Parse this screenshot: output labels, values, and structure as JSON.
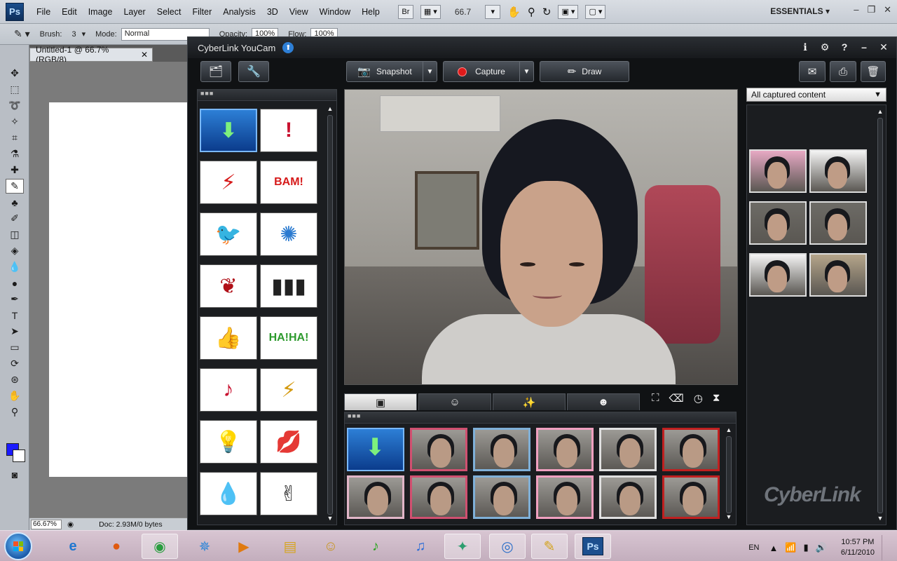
{
  "photoshop": {
    "logo": "Ps",
    "menu": [
      "File",
      "Edit",
      "Image",
      "Layer",
      "Select",
      "Filter",
      "Analysis",
      "3D",
      "View",
      "Window",
      "Help"
    ],
    "bridge_label": "Br",
    "zoom": "66.7",
    "workspace": "ESSENTIALS",
    "options": {
      "brush_label": "Brush:",
      "brush_size": "3",
      "mode_label": "Mode:",
      "mode_value": "Normal",
      "opacity_label": "Opacity:",
      "opacity_value": "100%",
      "flow_label": "Flow:",
      "flow_value": "100%"
    },
    "document_tab": "Untitled-1 @ 66.7% (RGB/8)",
    "status": {
      "zoom": "66.67%",
      "doc_info": "Doc: 2.93M/0 bytes"
    },
    "foreground_color": "#1a1aff",
    "background_color": "#ffffff"
  },
  "youcam": {
    "title": "CyberLink YouCam",
    "buttons": {
      "snapshot": "Snapshot",
      "capture": "Capture",
      "draw": "Draw"
    },
    "effects": [
      {
        "name": "download-effect",
        "text": "⬇",
        "selected": true
      },
      {
        "name": "exclaim-effect",
        "text": "!"
      },
      {
        "name": "zigzag-effect",
        "text": "⚡"
      },
      {
        "name": "bam-effect",
        "text": "BAM!"
      },
      {
        "name": "bird-effect",
        "text": "🐦"
      },
      {
        "name": "confetti-effect",
        "text": "✺"
      },
      {
        "name": "lips-confetti-effect",
        "text": "❦"
      },
      {
        "name": "fringe-effect",
        "text": "▮▮▮"
      },
      {
        "name": "thumbs-up-effect",
        "text": "👍"
      },
      {
        "name": "haha-effect",
        "text": "HA!HA!"
      },
      {
        "name": "music-note-effect",
        "text": "♪"
      },
      {
        "name": "lightning-burst-effect",
        "text": "⚡"
      },
      {
        "name": "lightbulb-effect",
        "text": "💡"
      },
      {
        "name": "kiss-effect",
        "text": "💋"
      },
      {
        "name": "drops-effect",
        "text": "💧"
      },
      {
        "name": "victory-hand-effect",
        "text": "✌"
      }
    ],
    "frames_row1": [
      "download-frame",
      "birthday-frame",
      "bubbles-frame",
      "heart-frame",
      "photo-stack-frame",
      "ribbon-frame"
    ],
    "frames_row2": [
      "camera-frame",
      "teddy-frame",
      "roses-frame",
      "scope-frame",
      "gift-frame",
      "sparkle-frame"
    ],
    "library_filter": "All captured content",
    "library": [
      "heart-capture",
      "ribbon-capture",
      "group-capture-1",
      "group-capture-2",
      "ribbon-capture-2",
      "hand-capture"
    ],
    "brand": "CyberLink"
  },
  "taskbar": {
    "apps": [
      {
        "name": "internet-explorer",
        "glyph": "e",
        "color": "#1f77d0",
        "open": false
      },
      {
        "name": "firefox",
        "glyph": "●",
        "color": "#e05a10",
        "open": false
      },
      {
        "name": "chrome",
        "glyph": "◉",
        "color": "#2a9d3f",
        "open": true
      },
      {
        "name": "safari",
        "glyph": "✵",
        "color": "#2d86d8",
        "open": false
      },
      {
        "name": "media-player",
        "glyph": "▶",
        "color": "#e07a10",
        "open": false
      },
      {
        "name": "explorer",
        "glyph": "▤",
        "color": "#d6a520",
        "open": false
      },
      {
        "name": "messenger",
        "glyph": "☺",
        "color": "#c9951e",
        "open": false
      },
      {
        "name": "music-app",
        "glyph": "♪",
        "color": "#2aa51f",
        "open": false
      },
      {
        "name": "itunes",
        "glyph": "♫",
        "color": "#2a6cd8",
        "open": false
      },
      {
        "name": "live-messenger",
        "glyph": "✦",
        "color": "#2d9e6f",
        "open": true
      },
      {
        "name": "youcam",
        "glyph": "◎",
        "color": "#2c6fc8",
        "open": true
      },
      {
        "name": "paint",
        "glyph": "✎",
        "color": "#d3a21a",
        "open": true
      },
      {
        "name": "photoshop",
        "glyph": "Ps",
        "color": "#1d4f8e",
        "open": true
      }
    ],
    "language": "EN",
    "time": "10:57 PM",
    "date": "6/11/2010"
  }
}
